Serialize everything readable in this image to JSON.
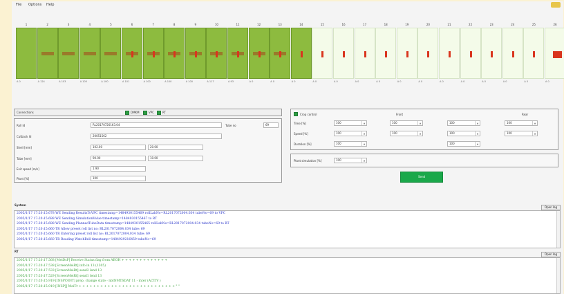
{
  "menu": [
    "File",
    "Options",
    "Help"
  ],
  "strip_numbers": [
    "1",
    "2",
    "3",
    "4",
    "5",
    "6",
    "7",
    "8",
    "9",
    "10",
    "11",
    "12",
    "13",
    "14",
    "15",
    "16",
    "17",
    "18",
    "19",
    "20",
    "21",
    "22",
    "23",
    "24",
    "25",
    "26"
  ],
  "strip_values": [
    "A 0",
    "A 124",
    "A 103",
    "A 105",
    "A 100",
    "A 101",
    "A 100",
    "A 100",
    "A 100",
    "A 117",
    "A 93",
    "A 0",
    "A 0",
    "A 0",
    "A 0",
    "A 0",
    "A 0",
    "A 0",
    "A 0",
    "A 0",
    "A 0",
    "A 0",
    "A 0",
    "A 0",
    "A 0",
    "A 0"
  ],
  "strip_active_count": 14,
  "colors": {
    "active": "#8dbb3f",
    "inactive": "#f4fbe9",
    "marker": "#d9351e",
    "send": "#1aa84a",
    "log_blue": "#2430c8",
    "log_green": "#3aa23a"
  },
  "connections": {
    "title": "Connections",
    "items": [
      "DMKM",
      "VPC",
      "RT"
    ]
  },
  "form": {
    "roll_id_label": "Roll Id",
    "roll_id_value": "RL20170720163.04",
    "tube_label": "Tube no",
    "tube_value": "69",
    "cutback_label": "Cutback Id",
    "cutback_value": "20051562",
    "shell_label": "Shell [mm]",
    "shell_values": [
      "102.00",
      "20.00"
    ],
    "tube_mm_label": "Tube [mm]",
    "tube_mm_values": [
      "90.00",
      "10.00"
    ],
    "exit_speed_label": "Exit speed [m/s]",
    "exit_speed_value": "1.90",
    "plant_label": "Plant [%]",
    "plant_value": "100"
  },
  "crop": {
    "checkbox_label": "Crop control",
    "front_label": "Front",
    "rear_label": "Rear",
    "rows": [
      {
        "label": "Time [%]",
        "values": [
          "100",
          "100",
          "100",
          "100"
        ]
      },
      {
        "label": "Speed [%]",
        "values": [
          "100",
          "100",
          "100",
          "100"
        ]
      },
      {
        "label": "Duration [%]",
        "values": [
          "100",
          "100"
        ]
      }
    ],
    "plant_sim_label": "Plant simulation [%]",
    "plant_sim_value": "100",
    "send_label": "Send"
  },
  "system_log": {
    "title": "System",
    "open_label": "Open log",
    "lines": [
      "2005/1/17 17:20:15.678 WE Sending ResultsToVPC timestamp=1484930155469 rollLabNo=RL2017072004.034 tubeNo=69 to VPC",
      "2005/1/17 17:20:15.688 WE Sending SimulationValue timestamp=1484930155467 to RT",
      "2005/1/17 17:20:15.688 WE Sending PlannedTubeData timestamp=1484930155465 rollLabNo=RL2017072004.034 tubeNo=69 to RT",
      "2005/1/17 17:20:15.660 TR Allow preset roll list no: RL2017072004.034 tube: 69",
      "2005/1/17 17:20:15.660 TR Entering preset roll list no: RL2017072004.034 tube: 69",
      "2005/1/17 17:20:15.660 TR Reading WatchBell timestamp=1484929216459 tubeNo=69"
    ]
  },
  "rt_log": {
    "title": "RT",
    "open_label": "Open log",
    "lines": [
      "2005/1/17 17:20:17.568 [MeiDsP] Receive Status flag from AEOH + + + + + + + + + + + + +",
      "2005/1/17 17:20:17.538 [ScreenMeiRt] info in 13 (1305)",
      "2005/1/17 17:20:17.533 [ScreenMeiRt] send2 lend 13",
      "2005/1/17 17:20:17.529 [ScreenMeiRt] send1 lend 13",
      "2005/1/17 17:20:15.919 [INSPC0NT] prep. change state - nbINMTSDAT 11 - inter (ACTIV )",
      "2005/1/17 17:20:15.919 [INSP]] MeiTr + + + + + + + + + + + + + + + + + + + + + + + + + + + \" \""
    ]
  }
}
